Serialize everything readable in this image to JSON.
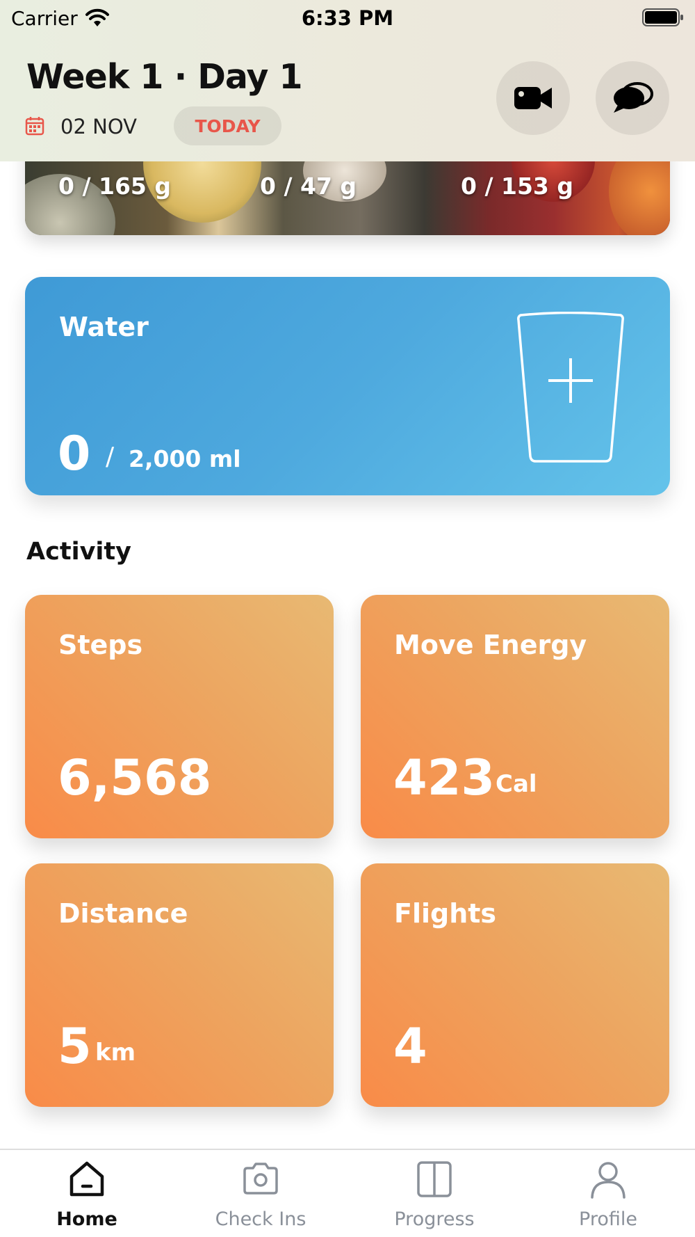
{
  "status_bar": {
    "carrier": "Carrier",
    "time": "6:33 PM"
  },
  "header": {
    "title": "Week 1 · Day 1",
    "date": "02 NOV",
    "today_badge": "TODAY"
  },
  "macros": {
    "values": [
      "0 / 165 g",
      "0 / 47 g",
      "0 / 153 g"
    ]
  },
  "water": {
    "title": "Water",
    "current": "0",
    "separator": "/",
    "goal": "2,000 ml"
  },
  "activity": {
    "heading": "Activity",
    "tiles": [
      {
        "title": "Steps",
        "value": "6,568",
        "unit": ""
      },
      {
        "title": "Move Energy",
        "value": "423",
        "unit": "Cal"
      },
      {
        "title": "Distance",
        "value": "5",
        "unit": "km"
      },
      {
        "title": "Flights",
        "value": "4",
        "unit": ""
      }
    ]
  },
  "tabs": [
    {
      "label": "Home",
      "icon": "home-icon",
      "active": true
    },
    {
      "label": "Check Ins",
      "icon": "camera-icon",
      "active": false
    },
    {
      "label": "Progress",
      "icon": "progress-icon",
      "active": false
    },
    {
      "label": "Profile",
      "icon": "person-icon",
      "active": false
    }
  ],
  "colors": {
    "accent_red": "#e8564a",
    "water_blue": "#4ea9de",
    "activity_orange": "#f4994f",
    "tab_inactive": "#8a9099"
  }
}
